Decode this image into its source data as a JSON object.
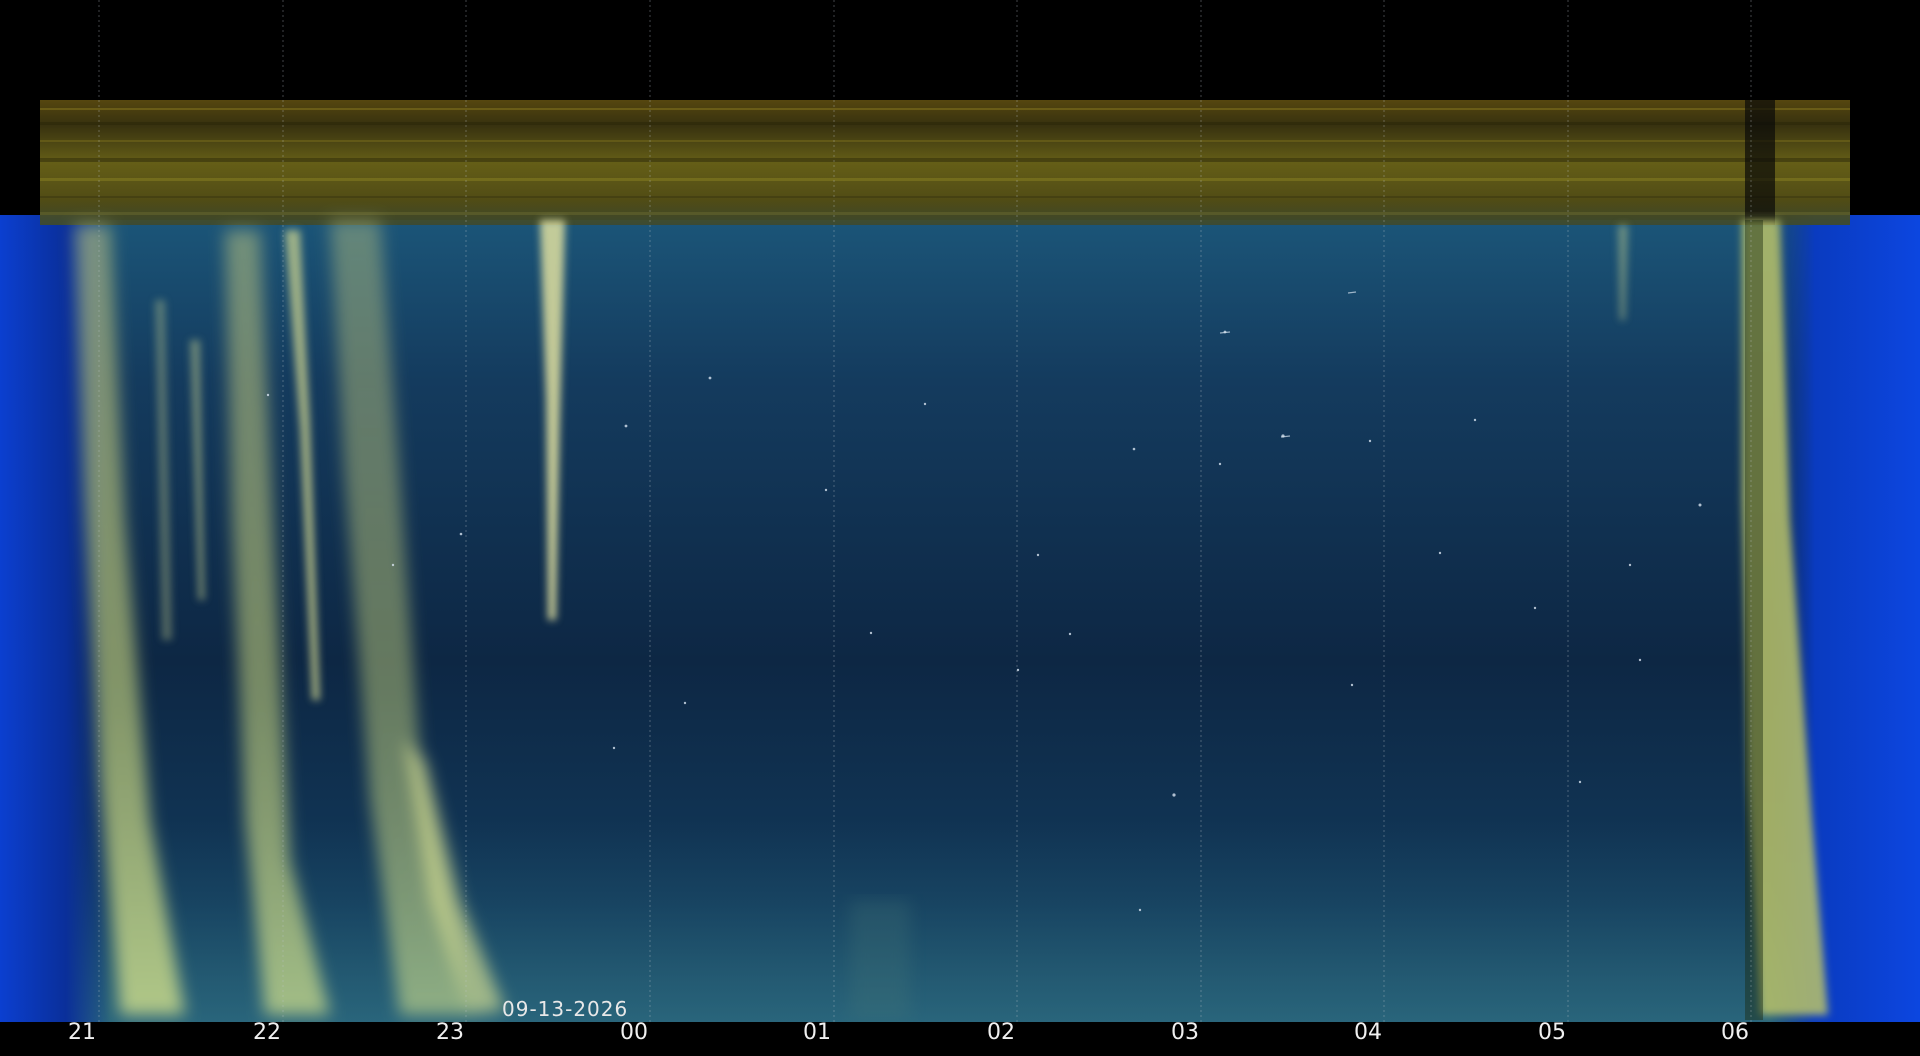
{
  "keogram": {
    "date_label": "09-13-2026",
    "hour_labels": [
      "21",
      "22",
      "23",
      "00",
      "01",
      "02",
      "03",
      "04",
      "05",
      "06"
    ]
  },
  "colors": {
    "sky_dark": "#0d2540",
    "sky_mid": "#164468",
    "twilight_blue": "#0a3fcf",
    "cloud_yellow": "#b9c26a",
    "horizon_band": "#5c5418",
    "background": "#000000"
  }
}
